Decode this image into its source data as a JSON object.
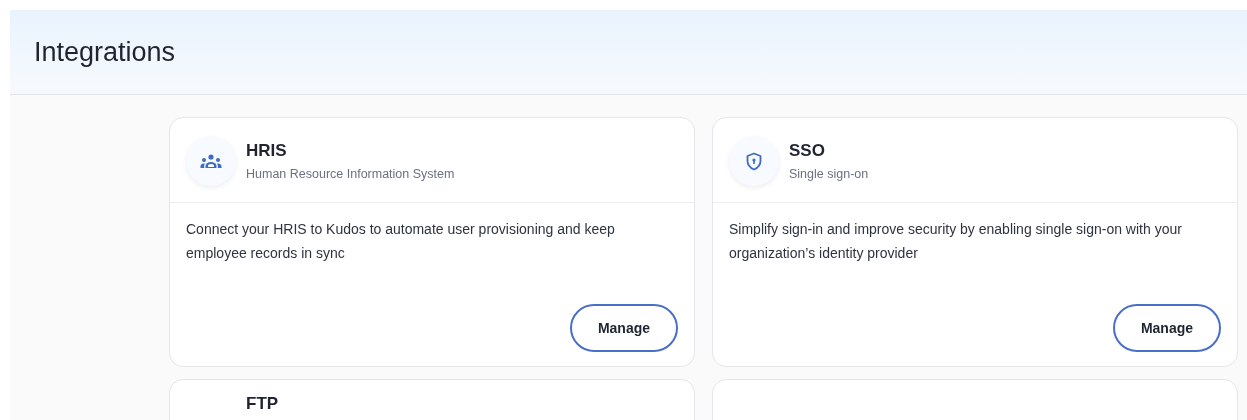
{
  "header": {
    "title": "Integrations"
  },
  "cards": [
    {
      "kind": "people",
      "title": "HRIS",
      "subtitle": "Human Resource Information System",
      "description": "Connect your HRIS to Kudos to automate user provisioning and keep employee records in sync",
      "button": "Manage"
    },
    {
      "kind": "shield",
      "title": "SSO",
      "subtitle": "Single sign-on",
      "description": "Simplify sign-in and improve security by enabling single sign-on with your organization’s identity provider",
      "button": "Manage"
    },
    {
      "kind": "plain",
      "title": "FTP"
    },
    {
      "kind": "plain"
    }
  ]
}
